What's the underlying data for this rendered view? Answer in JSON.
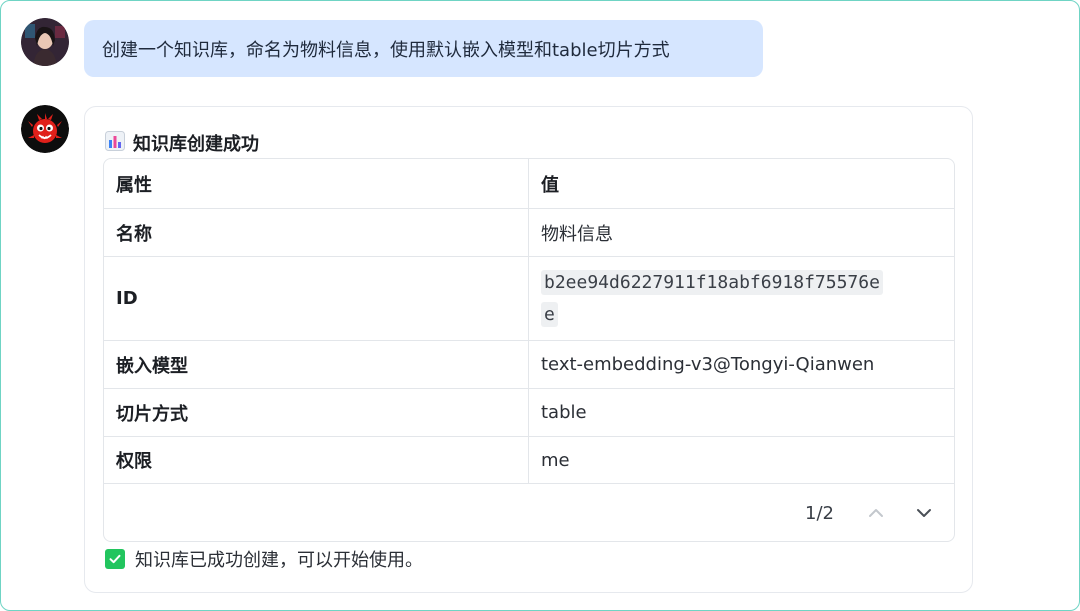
{
  "user_message": {
    "text": "创建一个知识库，命名为物料信息，使用默认嵌入模型和table切片方式"
  },
  "bot_message": {
    "title": "知识库创建成功",
    "title_icon": "bar-chart-icon",
    "table": {
      "headers": [
        "属性",
        "值"
      ],
      "rows": [
        {
          "key": "名称",
          "value": "物料信息"
        },
        {
          "key": "ID",
          "value_line1": "b2ee94d6227911f18abf6918f75576e",
          "value_line2": "e"
        },
        {
          "key": "嵌入模型",
          "value": "text-embedding-v3@Tongyi-Qianwen"
        },
        {
          "key": "切片方式",
          "value": "table"
        },
        {
          "key": "权限",
          "value": "me"
        }
      ]
    },
    "pager": {
      "label": "1/2"
    },
    "status": {
      "text": "知识库已成功创建，可以开始使用。",
      "icon": "check-box-icon"
    }
  },
  "colors": {
    "user_bubble": "#d6e6ff",
    "frame_border": "#6fd4c4",
    "success": "#22c55e"
  }
}
